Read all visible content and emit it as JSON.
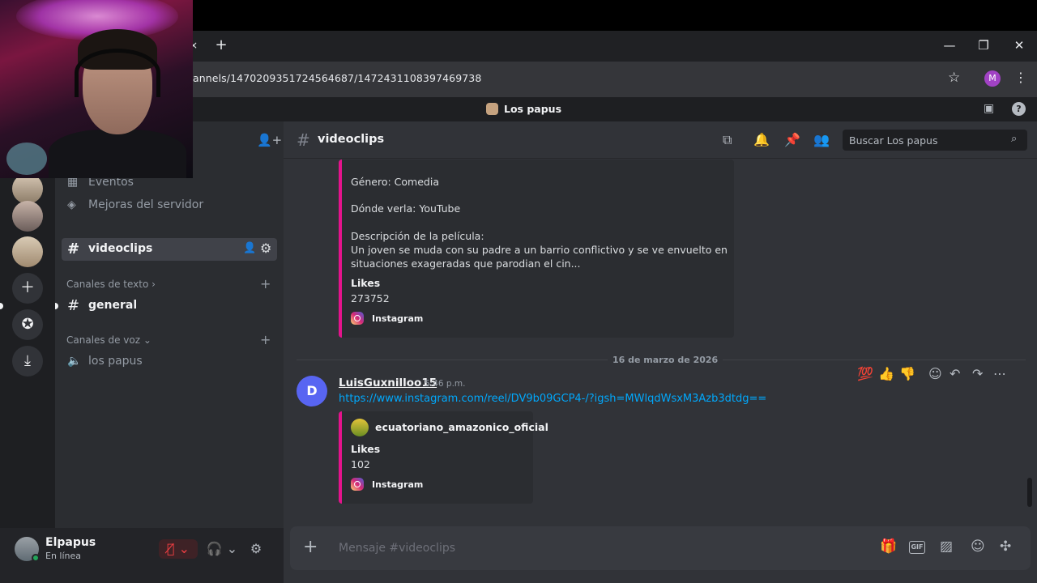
{
  "browser": {
    "url": "annels/1470209351724564687/1472431108397469738",
    "profile_initial": "M",
    "new_tab": "+",
    "tab_close": "×",
    "minimize": "—",
    "maximize": "❐",
    "close": "✕"
  },
  "discord": {
    "server_name": "Los papus",
    "channel_header": "videoclips",
    "search_placeholder": "Buscar Los papus",
    "sidebar": {
      "events": "Eventos",
      "boosts": "Mejoras del servidor",
      "active_channel": "videoclips",
      "text_category": "Canales de texto",
      "text_channels": [
        "general"
      ],
      "voice_category": "Canales de voz",
      "voice_channels": [
        "los papus"
      ]
    },
    "user": {
      "name": "Elpapus",
      "status": "En línea"
    },
    "messages": {
      "embed1": {
        "genre": "Género: Comedia",
        "where": "Dónde verla: YouTube",
        "desc_title": "Descripción de la película:",
        "desc_line1": "Un joven se muda con su padre a un barrio conflictivo y se ve envuelto en",
        "desc_line2": "situaciones exageradas que parodian el cin...",
        "likes_label": "Likes",
        "likes_value": "273752",
        "provider": "Instagram"
      },
      "date_divider": "16 de marzo de 2026",
      "post": {
        "author": "LuisGuxnilloo15",
        "time": "5:46 p.m.",
        "avatar_letter": "D",
        "link": "https://www.instagram.com/reel/DV9b09GCP4-/?igsh=MWlqdWsxM3Azb3dtdg==",
        "embed_author": "ecuatoriano_amazonico_oficial",
        "likes_label": "Likes",
        "likes_value": "102",
        "provider": "Instagram"
      },
      "reactions": [
        "💯",
        "👍",
        "👎"
      ]
    },
    "composer_placeholder": "Mensaje #videoclips"
  }
}
